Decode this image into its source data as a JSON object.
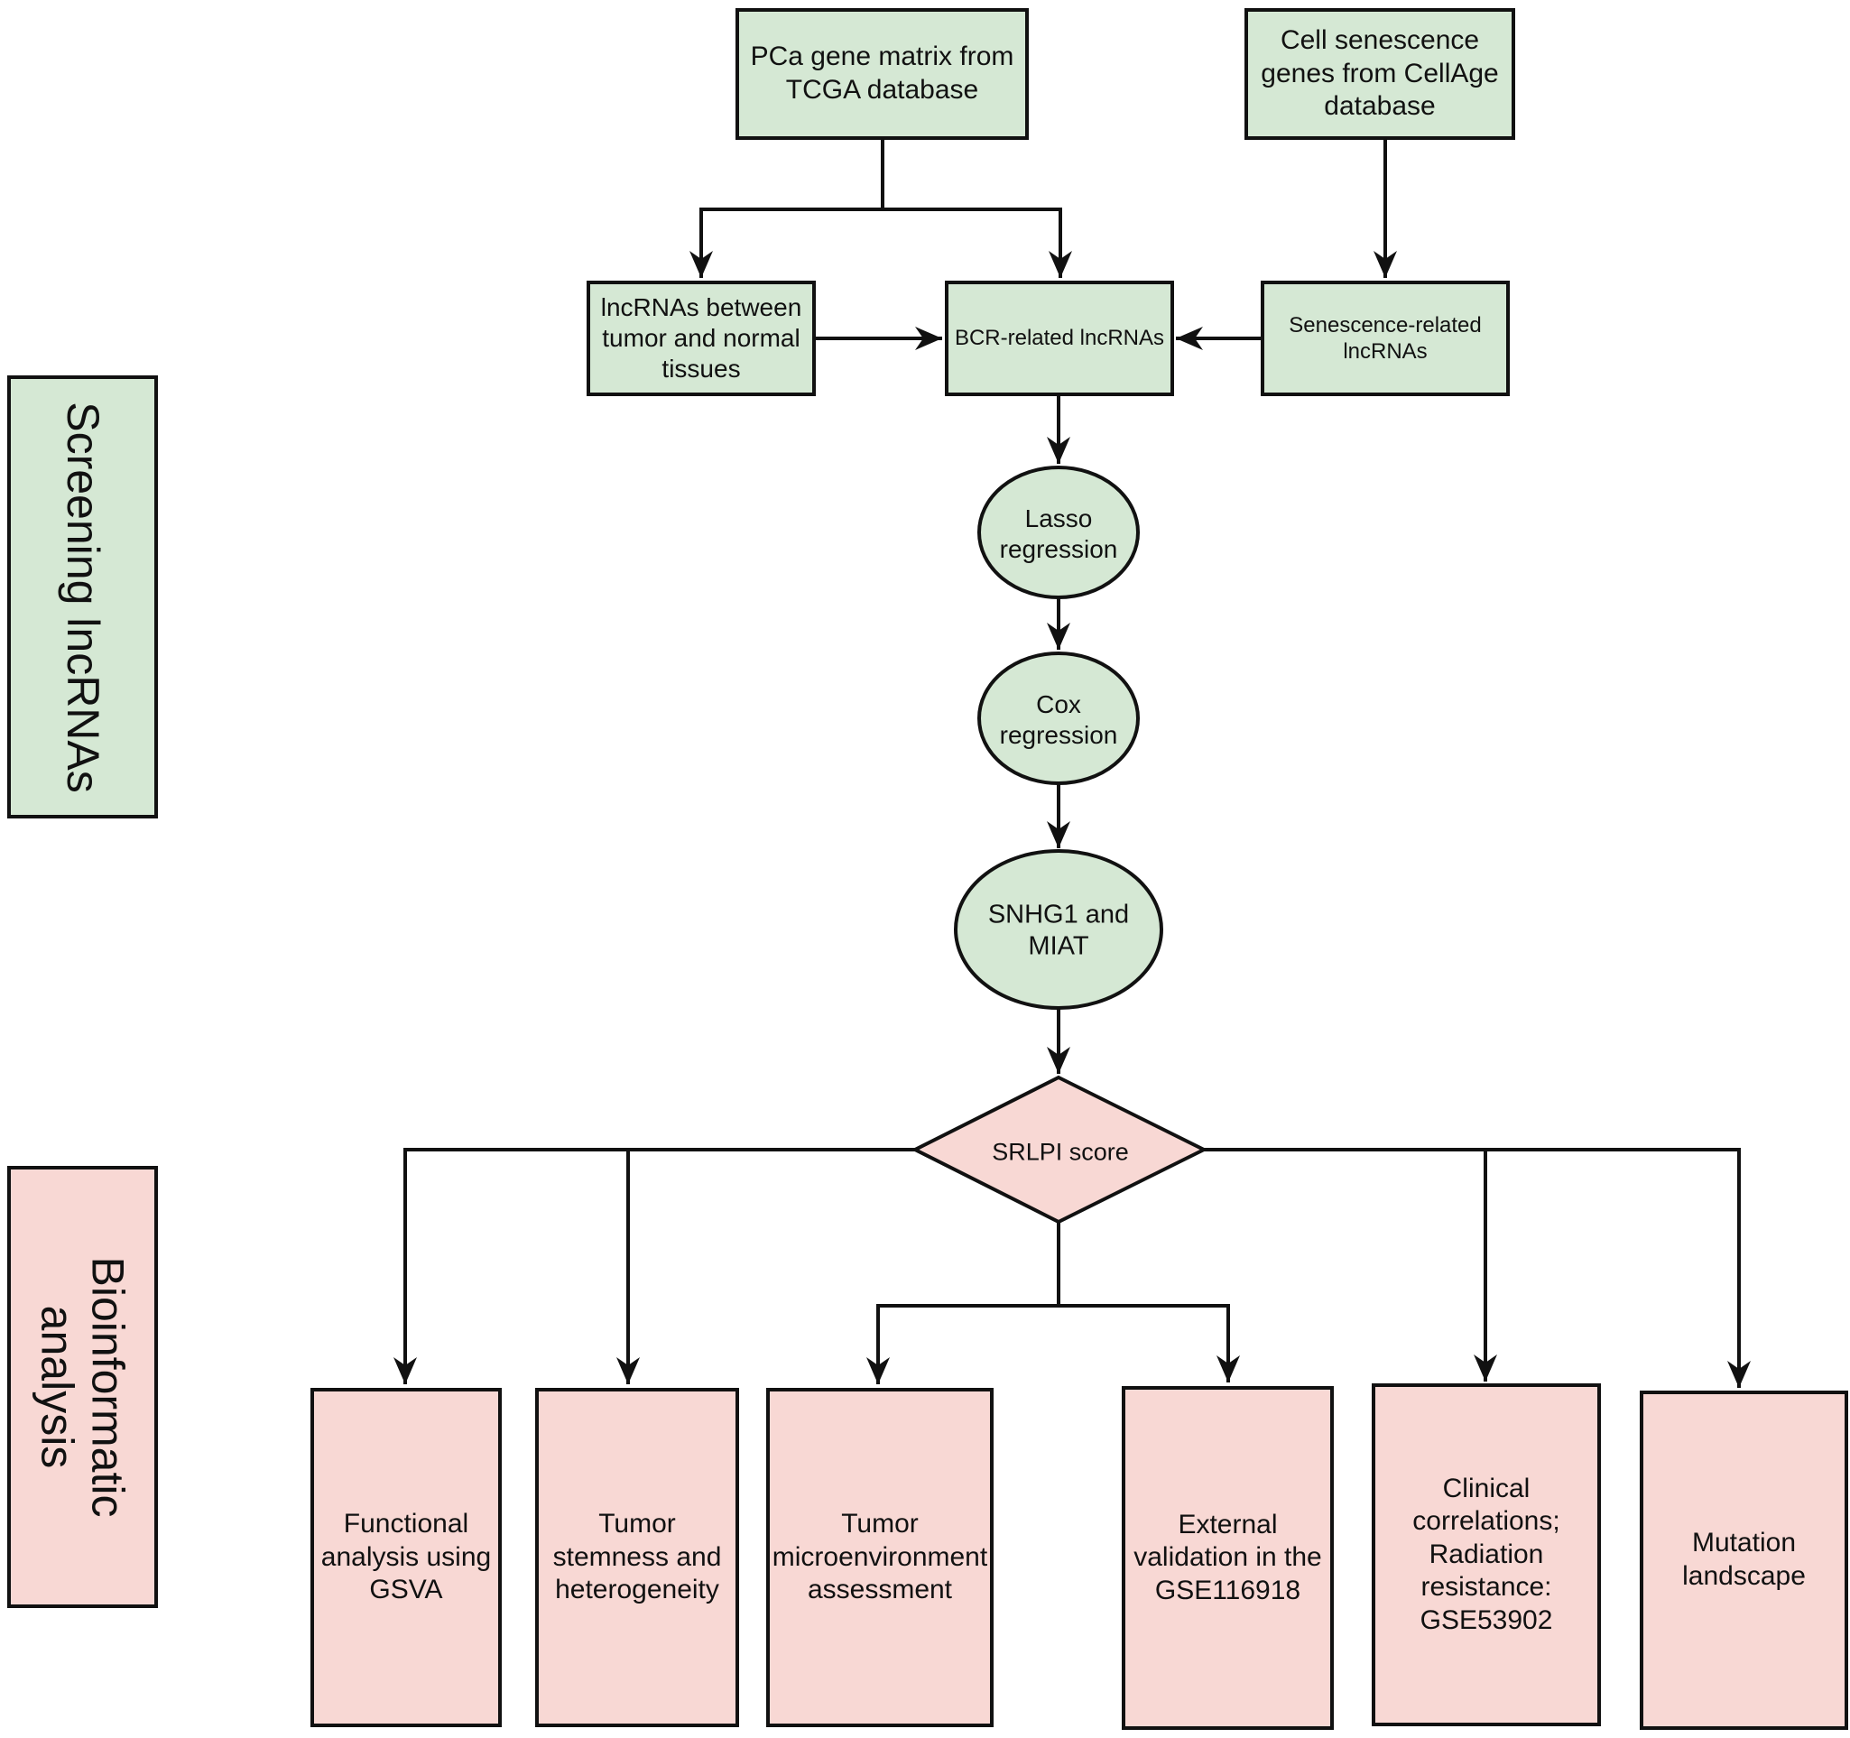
{
  "sections": {
    "screening": {
      "label": "Screening lncRNAs",
      "color": "#d5e8d4"
    },
    "bioinformatic": {
      "label": "Bioinformatic\nanalysis",
      "color": "#f8d8d4"
    }
  },
  "sources": {
    "tcga": "PCa gene matrix from\nTCGA database",
    "cellage": "Cell senescence\ngenes from CellAge\ndatabase"
  },
  "intermediate": {
    "differential": "lncRNAs between\ntumor and normal\ntissues",
    "bcr": "BCR-related lncRNAs",
    "senescence": "Senescence-related\nlncRNAs"
  },
  "steps": {
    "lasso": "Lasso\nregression",
    "cox": "Cox\nregression",
    "genes": "SNHG1 and\nMIAT"
  },
  "score": {
    "label": "SRLPI score",
    "color": "#f8d8d4"
  },
  "analyses": [
    {
      "label": "Functional\nanalysis using\nGSVA"
    },
    {
      "label": "Tumor\nstemness and\nheterogeneity"
    },
    {
      "label": "Tumor\nmicroenvironment\nassessment"
    },
    {
      "label": "External\nvalidation in the\nGSE116918"
    },
    {
      "label": "Clinical\ncorrelations;\nRadiation\nresistance:\nGSE53902"
    },
    {
      "label": "Mutation\nlandscape"
    }
  ],
  "colors": {
    "node_green": "#d5e8d4",
    "node_pink": "#f8d8d4",
    "stroke": "#111111"
  }
}
